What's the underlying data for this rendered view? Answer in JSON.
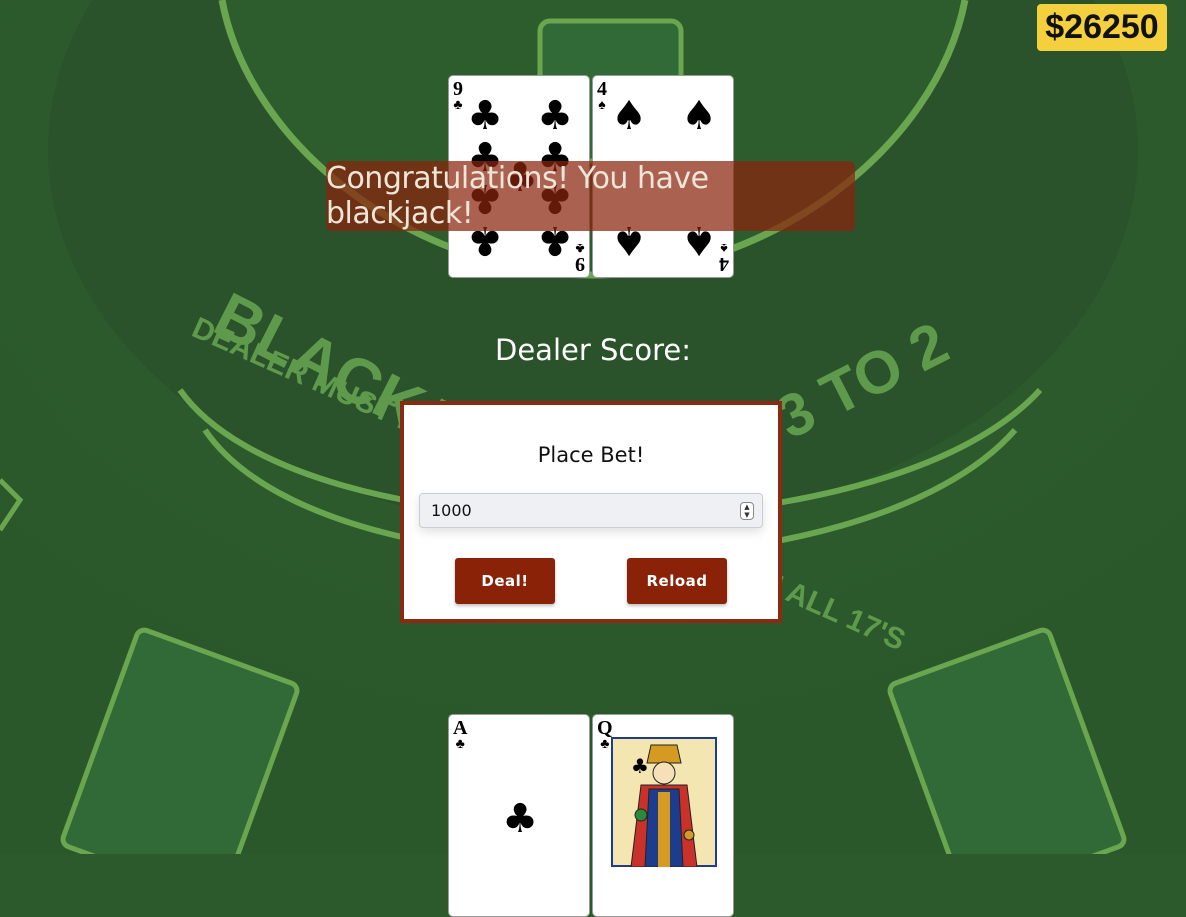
{
  "bank": {
    "amount": "$26250"
  },
  "banner": {
    "message": "Congratulations! You have blackjack!"
  },
  "dealer": {
    "score_label": "Dealer Score:",
    "cards": [
      {
        "rank": "9",
        "suit": "♣",
        "suit_name": "clubs"
      },
      {
        "rank": "4",
        "suit": "♠",
        "suit_name": "spades"
      }
    ]
  },
  "bet": {
    "title": "Place Bet!",
    "value": "1000",
    "deal_label": "Deal!",
    "reload_label": "Reload"
  },
  "player": {
    "cards": [
      {
        "rank": "A",
        "suit": "♣",
        "suit_name": "clubs"
      },
      {
        "rank": "Q",
        "suit": "♣",
        "suit_name": "clubs"
      }
    ]
  },
  "table": {
    "text_left": "BLACKJACK PAYS",
    "text_right": "3 TO 2",
    "text_sub": "DEALER MUST DRAW TO 16 AND STAND ON ALL 17'S"
  },
  "colors": {
    "felt": "#2c5a2c",
    "line": "#6aa650",
    "accent": "#8a2208",
    "bank": "#f4d03f"
  }
}
